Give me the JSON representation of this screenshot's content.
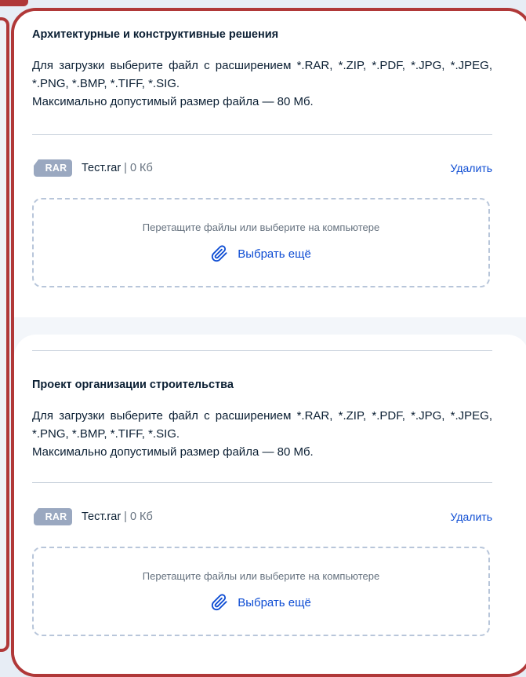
{
  "sections": [
    {
      "title": "Архитектурные и конструктивные решения",
      "hint_line1": "Для загрузки выберите файл с расширением *.RAR, *.ZIP, *.PDF, *.JPG, *.JPEG, *.PNG, *.BMP, *.TIFF, *.SIG.",
      "hint_line2": "Максимально допустимый размер файла — 80 Мб.",
      "file": {
        "ext": "RAR",
        "name": "Тест.rar",
        "size": "| 0 Кб",
        "delete_label": "Удалить"
      },
      "dropzone": {
        "hint": "Перетащите файлы или выберите на компьютере",
        "choose_label": "Выбрать ещё"
      }
    },
    {
      "title": "Проект организации строительства",
      "hint_line1": "Для загрузки выберите файл с расширением *.RAR, *.ZIP, *.PDF, *.JPG, *.JPEG, *.PNG, *.BMP, *.TIFF, *.SIG.",
      "hint_line2": "Максимально допустимый размер файла — 80 Мб.",
      "file": {
        "ext": "RAR",
        "name": "Тест.rar",
        "size": "| 0 Кб",
        "delete_label": "Удалить"
      },
      "dropzone": {
        "hint": "Перетащите файлы или выберите на компьютере",
        "choose_label": "Выбрать ещё"
      }
    }
  ],
  "colors": {
    "frame_red": "#b03838",
    "link_blue": "#0d4cd3",
    "badge_gray": "#9aa8c0"
  },
  "icons": {
    "attach": "paperclip-icon",
    "file_type": "file-extension-badge"
  }
}
